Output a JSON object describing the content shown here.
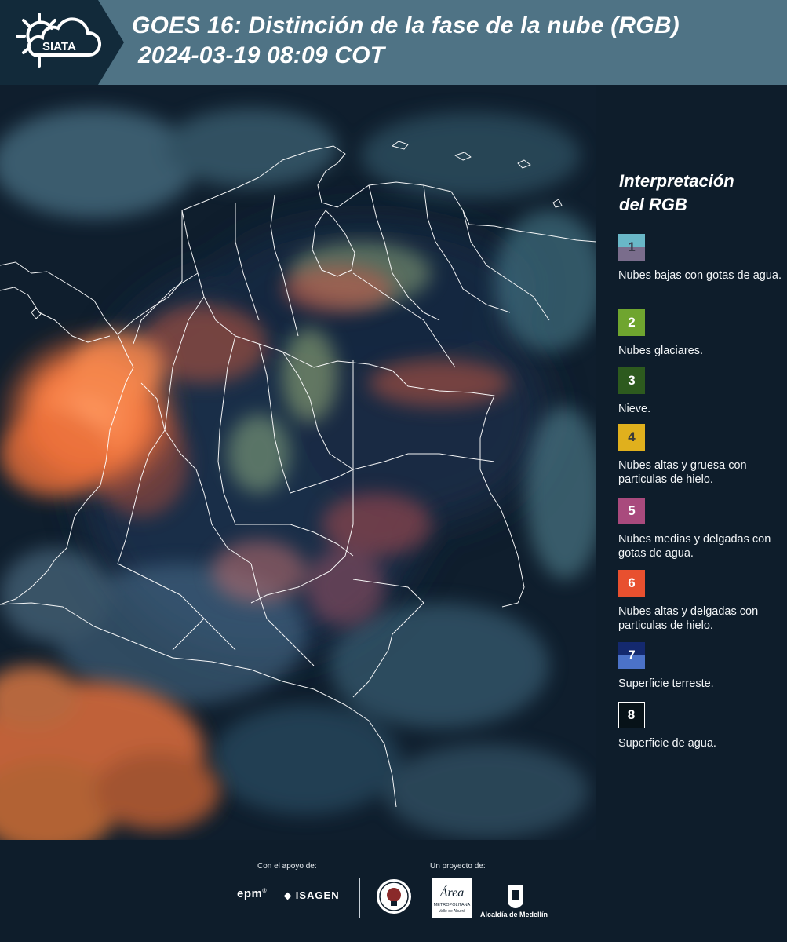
{
  "header": {
    "brand": "SIATA",
    "title_line1": "GOES 16: Distinción de la fase de la nube (RGB)",
    "title_line2": "2024-03-19 08:09 COT",
    "background_color": "#4f7385",
    "chevron_color": "#122a3a"
  },
  "legend": {
    "title_line1": "Interpretación",
    "title_line2": "del RGB",
    "items": [
      {
        "number": "1",
        "label": "Nubes bajas con gotas de agua.",
        "color_top": "#69b7c7",
        "color_bottom": "#7a6d8c",
        "text_color": "#3a3a4a"
      },
      {
        "number": "2",
        "label": "Nubes glaciares.",
        "color": "#6fa52f",
        "text_color": "#ffffff"
      },
      {
        "number": "3",
        "label": "Nieve.",
        "color": "#2d5a1e",
        "text_color": "#ffffff"
      },
      {
        "number": "4",
        "label": "Nubes altas y gruesa con particulas de hielo.",
        "color": "#e0b01d",
        "text_color": "#3a3a3a"
      },
      {
        "number": "5",
        "label": "Nubes medias y delgadas con gotas de agua.",
        "color": "#a94a7d",
        "text_color": "#ffffff"
      },
      {
        "number": "6",
        "label": "Nubes altas y delgadas con particulas de hielo.",
        "color": "#e8502f",
        "text_color": "#ffffff"
      },
      {
        "number": "7",
        "label": "Superficie terreste.",
        "color_top": "#14296e",
        "color_bottom": "#4b72c8",
        "text_color": "#ffffff"
      },
      {
        "number": "8",
        "label": "Superficie de agua.",
        "color": "#071218",
        "text_color": "#ffffff"
      }
    ]
  },
  "footer": {
    "support_label": "Con el apoyo de:",
    "project_label": "Un proyecto de:",
    "sponsor1": "epm",
    "sponsor2": "ISAGEN",
    "area_text1": "Área",
    "area_text2": "METROPOLITANA",
    "area_text3": "Valle de Aburrá",
    "alcaldia": "Alcaldía de Medellín"
  },
  "icons": {
    "logo": "siata-sun-cloud-icon"
  }
}
